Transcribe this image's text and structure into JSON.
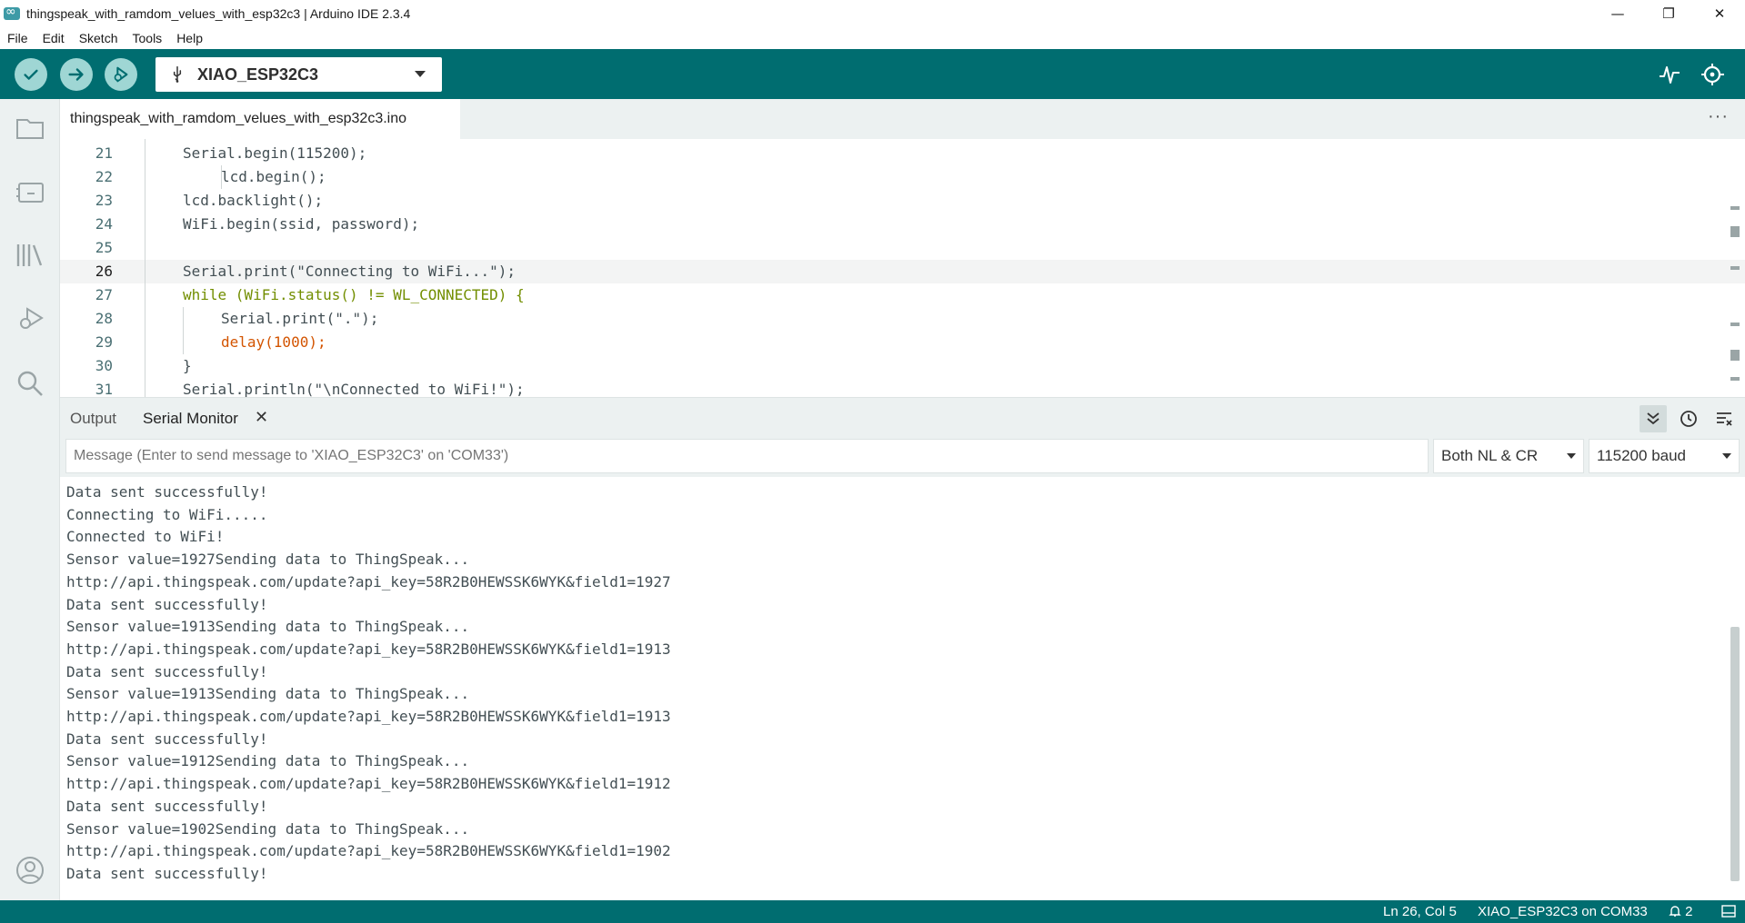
{
  "window": {
    "title": "thingspeak_with_ramdom_velues_with_esp32c3 | Arduino IDE 2.3.4",
    "minimize_glyph": "—",
    "maximize_glyph": "❐",
    "close_glyph": "✕"
  },
  "menu": [
    "File",
    "Edit",
    "Sketch",
    "Tools",
    "Help"
  ],
  "toolbar": {
    "board": "XIAO_ESP32C3",
    "accent": "#006d70"
  },
  "editor": {
    "tab": "thingspeak_with_ramdom_velues_with_esp32c3.ino",
    "more": "···",
    "lines": [
      {
        "no": "21",
        "text": "Serial.begin(115200);"
      },
      {
        "no": "22",
        "text": "lcd.begin();"
      },
      {
        "no": "23",
        "text": "lcd.backlight();"
      },
      {
        "no": "24",
        "text": "WiFi.begin(ssid, password);"
      },
      {
        "no": "25",
        "text": ""
      },
      {
        "no": "26",
        "text": "Serial.print(\"Connecting to WiFi...\");"
      },
      {
        "no": "27",
        "text": "while (WiFi.status() != WL_CONNECTED) {"
      },
      {
        "no": "28",
        "text": "Serial.print(\".\");"
      },
      {
        "no": "29",
        "text": "delay(1000);"
      },
      {
        "no": "30",
        "text": "}"
      },
      {
        "no": "31",
        "text": "Serial.println(\"\\nConnected to WiFi!\");"
      }
    ]
  },
  "panel": {
    "tabs": [
      "Output",
      "Serial Monitor"
    ],
    "close_glyph": "✕",
    "message_placeholder": "Message (Enter to send message to 'XIAO_ESP32C3' on 'COM33')",
    "line_ending": "Both NL & CR",
    "baud": "115200 baud",
    "serial_lines": [
      "Data sent successfully!",
      "Connecting to WiFi.....",
      "Connected to WiFi!",
      "Sensor value=1927Sending data to ThingSpeak...",
      "http://api.thingspeak.com/update?api_key=58R2B0HEWSSK6WYK&field1=1927",
      "Data sent successfully!",
      "Sensor value=1913Sending data to ThingSpeak...",
      "http://api.thingspeak.com/update?api_key=58R2B0HEWSSK6WYK&field1=1913",
      "Data sent successfully!",
      "Sensor value=1913Sending data to ThingSpeak...",
      "http://api.thingspeak.com/update?api_key=58R2B0HEWSSK6WYK&field1=1913",
      "Data sent successfully!",
      "Sensor value=1912Sending data to ThingSpeak...",
      "http://api.thingspeak.com/update?api_key=58R2B0HEWSSK6WYK&field1=1912",
      "Data sent successfully!",
      "Sensor value=1902Sending data to ThingSpeak...",
      "http://api.thingspeak.com/update?api_key=58R2B0HEWSSK6WYK&field1=1902",
      "Data sent successfully!"
    ]
  },
  "status": {
    "position": "Ln 26, Col 5",
    "board_port": "XIAO_ESP32C3 on COM33",
    "notifications": "2"
  }
}
